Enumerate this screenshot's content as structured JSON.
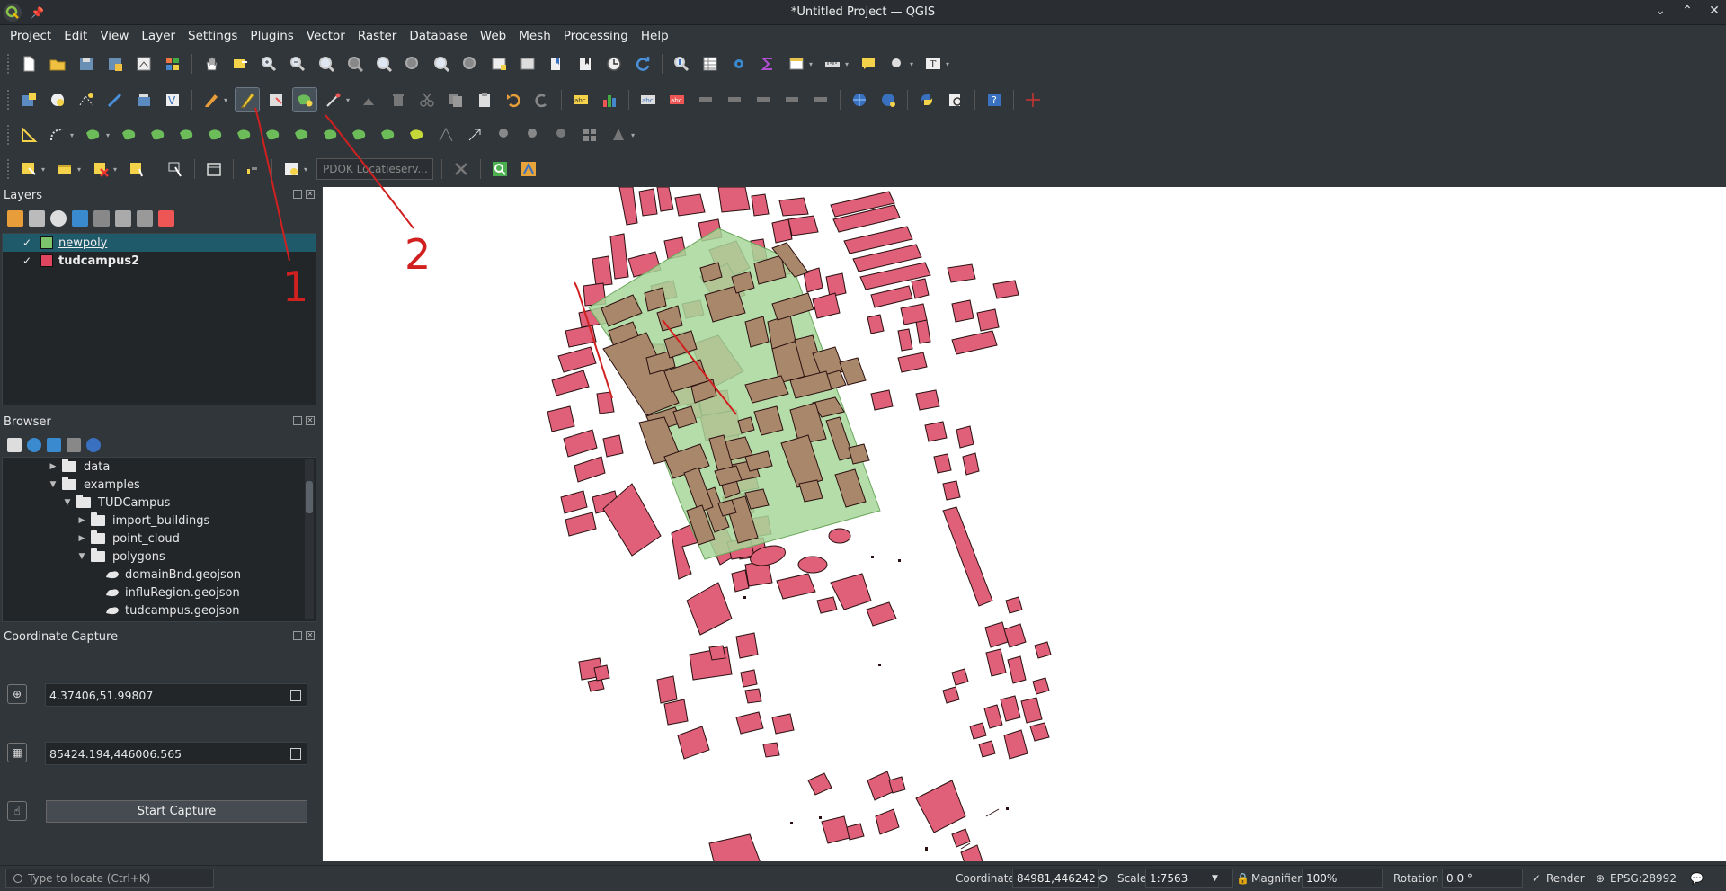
{
  "window": {
    "title": "*Untitled Project — QGIS",
    "app_icon": "qgis-logo",
    "pin_icon": "pin-icon"
  },
  "menubar": [
    "Project",
    "Edit",
    "View",
    "Layer",
    "Settings",
    "Plugins",
    "Vector",
    "Raster",
    "Database",
    "Web",
    "Mesh",
    "Processing",
    "Help"
  ],
  "toolbar4": {
    "locator_label": "PDOK Locatieserv..."
  },
  "layers_panel": {
    "title": "Layers",
    "layers": [
      {
        "name": "newpoly",
        "checked": "✓",
        "icon_color": "#7cc36b",
        "selected": true
      },
      {
        "name": "tudcampus2",
        "checked": "✓",
        "icon_color": "#e0455f",
        "selected": false
      }
    ]
  },
  "browser_panel": {
    "title": "Browser",
    "items": [
      {
        "label": "data",
        "indent": 1,
        "expander": "▶",
        "kind": "folder"
      },
      {
        "label": "examples",
        "indent": 1,
        "expander": "▼",
        "kind": "folder"
      },
      {
        "label": "TUDCampus",
        "indent": 2,
        "expander": "▼",
        "kind": "folder"
      },
      {
        "label": "import_buildings",
        "indent": 3,
        "expander": "▶",
        "kind": "folder"
      },
      {
        "label": "point_cloud",
        "indent": 3,
        "expander": "▶",
        "kind": "folder"
      },
      {
        "label": "polygons",
        "indent": 3,
        "expander": "▼",
        "kind": "folder"
      },
      {
        "label": "domainBnd.geojson",
        "indent": 4,
        "expander": "",
        "kind": "polygon"
      },
      {
        "label": "influRegion.geojson",
        "indent": 4,
        "expander": "",
        "kind": "polygon"
      },
      {
        "label": "tudcampus.geojson",
        "indent": 4,
        "expander": "",
        "kind": "polygon"
      }
    ]
  },
  "coordinate_capture": {
    "title": "Coordinate Capture",
    "wgs84_value": "4.37406,51.99807",
    "projected_value": "85424.194,446006.565",
    "start_button": "Start Capture"
  },
  "annotations": {
    "label_1": "1",
    "label_2": "2",
    "color": "#d02020"
  },
  "map": {
    "background": "#ffffff",
    "building_fill": "#e0607a",
    "building_stroke": "#2a1010",
    "newpoly_fill": "#a8d79a",
    "overlap_fill": "#a8876a"
  },
  "statusbar": {
    "locator_placeholder": "Type to locate (Ctrl+K)",
    "coordinate_label": "Coordinate",
    "coordinate_value": "84981,446242",
    "scale_label": "Scale",
    "scale_value": "1:7563",
    "magnifier_label": "Magnifier",
    "magnifier_value": "100%",
    "rotation_label": "Rotation",
    "rotation_value": "0.0 °",
    "render_label": "Render",
    "render_checked": "✓",
    "crs_label": "EPSG:28992"
  }
}
